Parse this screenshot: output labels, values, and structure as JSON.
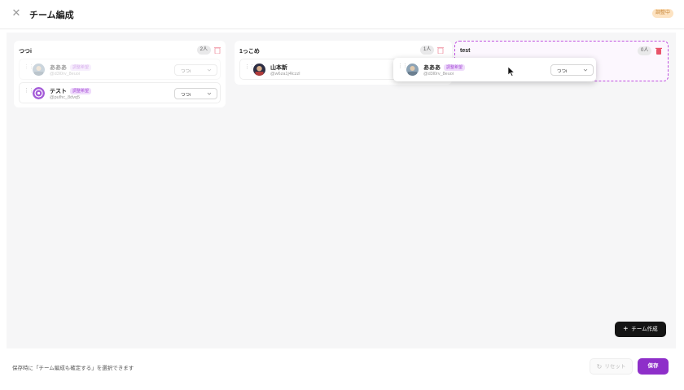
{
  "header": {
    "title": "チーム編成",
    "status_chip": "調整中"
  },
  "teams": [
    {
      "name": "つつi",
      "count": "2人",
      "members": [
        {
          "name": "あああ",
          "badge": "調整希望",
          "handle": "@d3l0rv_8euoi",
          "role": "つつi"
        },
        {
          "name": "テスト",
          "badge": "調整希望",
          "handle": "@pufhc_8dvq5",
          "role": "つつi"
        }
      ]
    },
    {
      "name": "1っこめ",
      "count": "1人",
      "members": [
        {
          "name": "山本新",
          "handle": "@w6za1j4lczzl"
        }
      ]
    },
    {
      "name": "test",
      "count": "0人",
      "members": []
    }
  ],
  "dragging": {
    "name": "あああ",
    "badge": "調整希望",
    "handle": "@d3l0rv_8euoi",
    "role": "つつi"
  },
  "actions": {
    "create_team": "チーム作成",
    "reset": "リセット",
    "save": "保存"
  },
  "footer": {
    "note": "保存時に「チーム編成も確定する」を選択できます"
  },
  "colors": {
    "accent": "#8e2fc9",
    "badge_bg": "#efdcfb",
    "drop_border": "#c04fe0"
  }
}
